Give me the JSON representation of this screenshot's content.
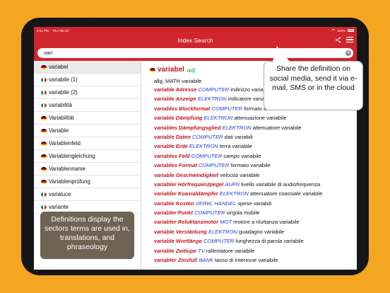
{
  "status_bar": {
    "time": "2:51 PM",
    "date": "Thu Feb 20",
    "battery": "100%"
  },
  "navbar": {
    "title": "Index Search"
  },
  "search": {
    "value": "vari"
  },
  "index_items": [
    {
      "label": "variabel",
      "flag": "de",
      "selected": true
    },
    {
      "label": "variabile (1)",
      "flag": "it"
    },
    {
      "label": "variabile (2)",
      "flag": "it"
    },
    {
      "label": "variabilità",
      "flag": "it"
    },
    {
      "label": "Variabilität",
      "flag": "de"
    },
    {
      "label": "Variable",
      "flag": "de"
    },
    {
      "label": "Variablenfeld",
      "flag": "de"
    },
    {
      "label": "Variablengleichung",
      "flag": "de"
    },
    {
      "label": "Variablenname",
      "flag": "de"
    },
    {
      "label": "Variablenprüfung",
      "flag": "de"
    },
    {
      "label": "varialuce",
      "flag": "it"
    },
    {
      "label": "variante",
      "flag": "it"
    }
  ],
  "entry": {
    "headword": "variabel",
    "pos": "adj",
    "sectors": "allg, MATH",
    "sector_translation": "variabile",
    "lines": [
      {
        "de": "variable Adresse",
        "dom": "COMPUTER",
        "it": "indirizzo variabile"
      },
      {
        "de": "variable Anzeige",
        "dom": "ELEKTRON",
        "it": "indicatore variabile"
      },
      {
        "de": "variables Blockformat",
        "dom": "COMPUTER",
        "it": "formato a blocchi variabili"
      },
      {
        "de": "variable Dämpfung",
        "dom": "ELEKTRON",
        "it": "attenuazione variabile"
      },
      {
        "de": "variables Dämpfungsglied",
        "dom": "ELEKTRON",
        "it": "attenuatore variabile"
      },
      {
        "de": "variable Daten",
        "dom": "COMPUTER",
        "it": "dati variabili"
      },
      {
        "de": "variable Erde",
        "dom": "ELEKTRON",
        "it": "terra variabile"
      },
      {
        "de": "variables Feld",
        "dom": "COMPUTER",
        "it": "campo variabile"
      },
      {
        "de": "variables Format",
        "dom": "COMPUTER",
        "it": "formato variabile"
      },
      {
        "de": "variable Geschwindigkeit",
        "dom": "",
        "it": "velocità variabile"
      },
      {
        "de": "variabler Hörfrequenzpegel",
        "dom": "AUFN",
        "it": "livello variabile di audiofrequenza"
      },
      {
        "de": "variabler Koaxialdämpfer",
        "dom": "ELEKTRON",
        "it": "attenuatore coassiale variabile"
      },
      {
        "de": "variable Kosten",
        "dom": "VERW, HANDEL",
        "it": "spese variabili"
      },
      {
        "de": "variabler Punkt",
        "dom": "COMPUTER",
        "it": "virgola mobile"
      },
      {
        "de": "variabler Reluktanzmotor",
        "dom": "MOT",
        "it": "motore a riluttanza variabile"
      },
      {
        "de": "variable Verstärkung",
        "dom": "ELEKTRON",
        "it": "guadagno variabile"
      },
      {
        "de": "variable Wortlänge",
        "dom": "COMPUTER",
        "it": "lunghezza di parola variabile"
      },
      {
        "de": "variable Zeitlupe",
        "dom": "TV",
        "it": "rallentatore variabile"
      },
      {
        "de": "variabler Zinsfuß",
        "dom": "BANK",
        "it": "tasso di interesse variabile"
      }
    ]
  },
  "callouts": {
    "share": "Share the definition on social media, send it via e-mail, SMS or in the cloud",
    "definitions": "Definitions display the sectors terms are used in, translations, and phraseology"
  }
}
